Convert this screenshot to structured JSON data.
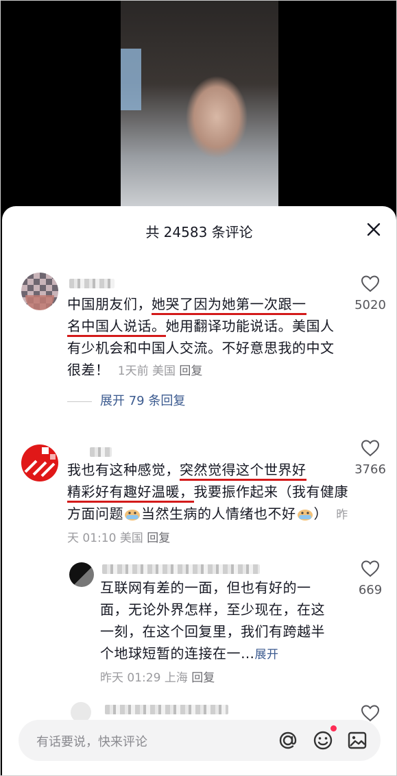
{
  "sheet": {
    "title": "共 24583 条评论"
  },
  "comments": [
    {
      "text_plain_1": "中国朋友们，",
      "text_ul_1": "她哭了因为她第一次跟一",
      "text_ul_2": "名中国人说话。",
      "text_plain_2": "她用翻译功能说话。美国人有少机会和中国人交流。不好意思我的中文很差！",
      "meta_time": "1天前",
      "meta_loc": "美国",
      "meta_reply": "回复",
      "likes": "5020",
      "expand_label": "展开 79 条回复"
    },
    {
      "text_plain_1": "我也有这种感觉，",
      "text_ul_1": "突然觉得这个世界好",
      "text_ul_2": "精彩好有趣好温暖，",
      "text_plain_2": "我要振作起来（我有健康方面问题",
      "text_plain_3": "当然生病的人情绪也不好",
      "text_plain_4": "）",
      "meta_time": "昨天 01:10",
      "meta_loc": "美国",
      "meta_reply": "回复",
      "likes": "3766"
    }
  ],
  "reply": {
    "text": "互联网有差的一面，但也有好的一面，无论外界怎样，至少现在，在这一刻，在这个回复里，我们有跨越半个地球短暂的连接在一…",
    "expand": "展开",
    "meta_time": "昨天 01:29",
    "meta_loc": "上海",
    "meta_reply": "回复",
    "likes": "669"
  },
  "input": {
    "placeholder": "有话要说，快来评论"
  },
  "icons": [
    "close-icon",
    "heart-icon",
    "at-icon",
    "emoji-icon",
    "image-icon",
    "crying-emoji-icon"
  ],
  "colors": {
    "underline": "#d31a1a",
    "link": "#3b5a8f",
    "notification_dot": "#fe2c55"
  }
}
